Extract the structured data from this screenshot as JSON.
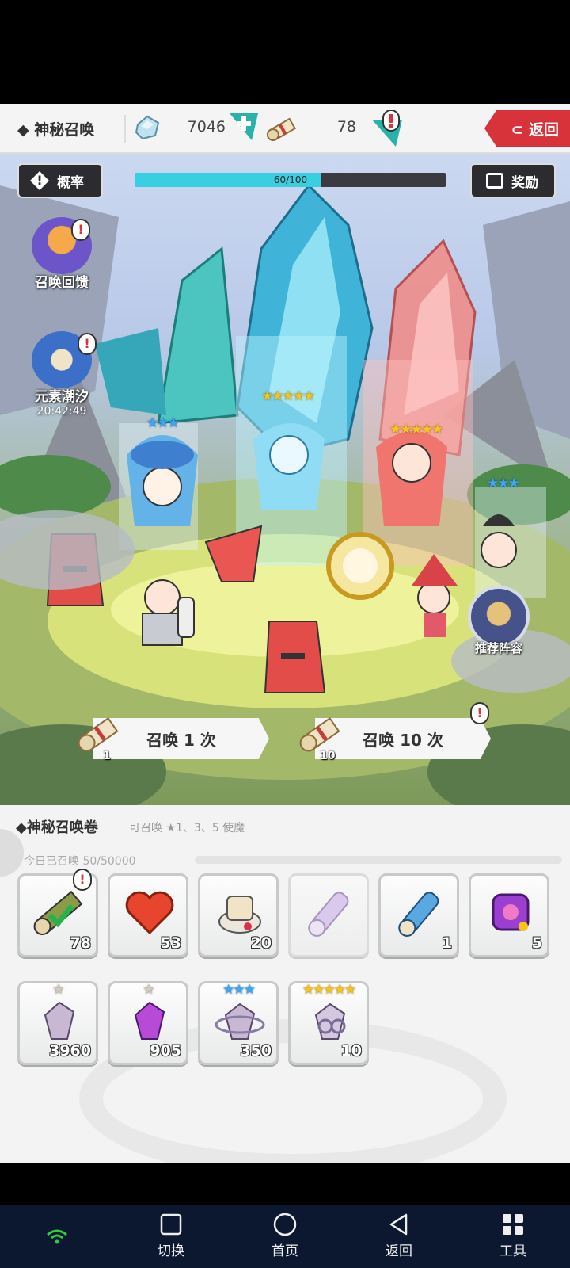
{
  "header": {
    "title": "◆ 神秘召唤",
    "gem_count": "7046",
    "scroll_count": "78",
    "back_label": "⊂ 返回"
  },
  "scene": {
    "probability_label": "概率",
    "reward_label": "奖励",
    "progress_text": "60/100",
    "progress_fraction": 0.6,
    "side_items": [
      {
        "label": "召唤回馈"
      },
      {
        "label": "元素潮汐",
        "timer": "20:42:49"
      }
    ],
    "recommend_label": "推荐阵容",
    "summon_once": {
      "label": "召唤 1 次",
      "scroll_count": "1"
    },
    "summon_ten": {
      "label": "召唤 10 次",
      "scroll_count": "10"
    },
    "star_labels": {
      "center": "★★★★★",
      "right": "★★★★★",
      "left_blue": "★★★",
      "far_right_blue": "★★★"
    }
  },
  "panel": {
    "title": "◆神秘召唤卷",
    "subtitle": "可召唤 ★1、3、5 使魔",
    "today": "今日已召唤 50/50000",
    "row1": [
      {
        "name": "summon-scroll",
        "count": "78"
      },
      {
        "name": "heart",
        "count": "53"
      },
      {
        "name": "bone-scroll",
        "count": "20"
      },
      {
        "name": "purple-scroll",
        "count": ""
      },
      {
        "name": "blue-scroll",
        "count": "1"
      },
      {
        "name": "magic-scroll",
        "count": "5"
      }
    ],
    "row2": [
      {
        "name": "crystal-1star",
        "count": "3960",
        "stars": "★"
      },
      {
        "name": "crystal-1star-purple",
        "count": "905",
        "stars": "★"
      },
      {
        "name": "crystal-3star",
        "count": "350",
        "stars": "★★★"
      },
      {
        "name": "crystal-5star",
        "count": "10",
        "stars": "★★★★★"
      }
    ]
  },
  "nav": {
    "items": [
      {
        "label": "切换"
      },
      {
        "label": "首页"
      },
      {
        "label": "返回"
      },
      {
        "label": "工具"
      }
    ]
  },
  "colors": {
    "accent_red": "#d8333a",
    "progress_cyan": "#38d0e0",
    "nav_bg": "#0b1830",
    "star_gold": "#f7c51a",
    "star_blue": "#3ea6f5"
  }
}
